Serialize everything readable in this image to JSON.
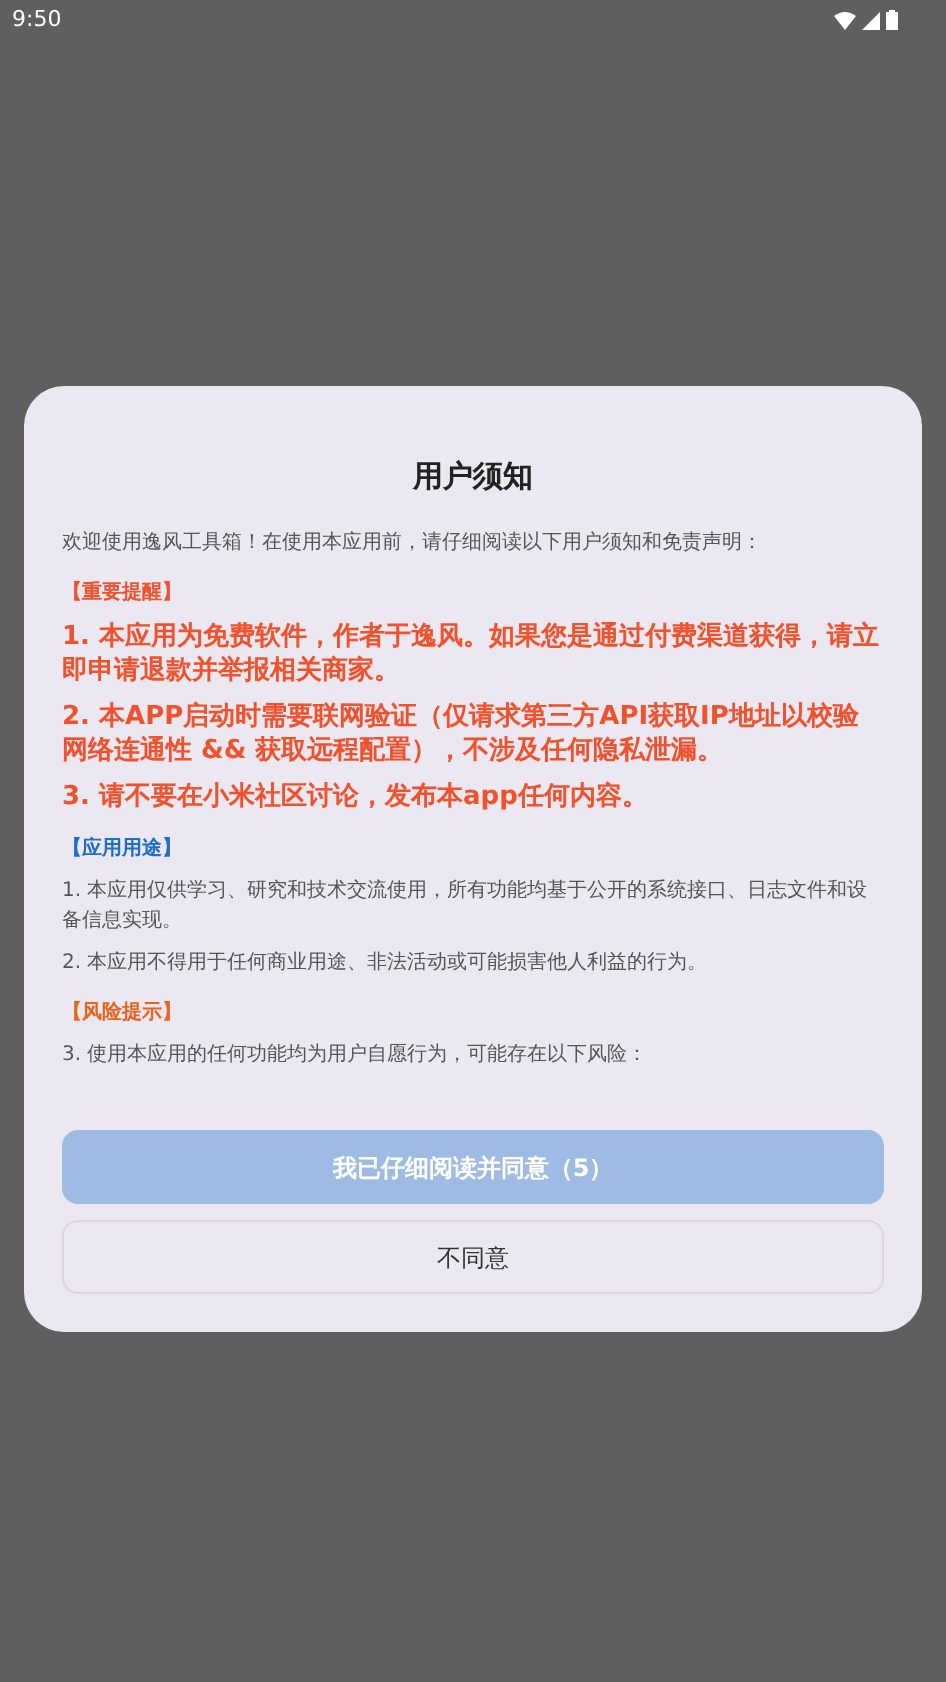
{
  "status_bar": {
    "time": "9:50"
  },
  "dialog": {
    "title": "用户须知",
    "blocks": [
      {
        "kind": "body",
        "text": "欢迎使用逸风工具箱！在使用本应用前，请仔细阅读以下用户须知和免责声明："
      },
      {
        "kind": "heading",
        "text": "【重要提醒】",
        "color": "#f0522e"
      },
      {
        "kind": "warning",
        "text": "1. 本应用为免费软件，作者于逸风。如果您是通过付费渠道获得，请立即申请退款并举报相关商家。"
      },
      {
        "kind": "warning",
        "text": "2. 本APP启动时需要联网验证（仅请求第三方API获取IP地址以校验网络连通性 && 获取远程配置），不涉及任何隐私泄漏。"
      },
      {
        "kind": "warning",
        "text": "3. 请不要在小米社区讨论，发布本app任何内容。"
      },
      {
        "kind": "heading",
        "text": "【应用用途】",
        "color": "#1e6fc7"
      },
      {
        "kind": "body",
        "text": "1. 本应用仅供学习、研究和技术交流使用，所有功能均基于公开的系统接口、日志文件和设备信息实现。"
      },
      {
        "kind": "body",
        "text": "2. 本应用不得用于任何商业用途、非法活动或可能损害他人利益的行为。"
      },
      {
        "kind": "heading",
        "text": "【风险提示】",
        "color": "#e8641e"
      },
      {
        "kind": "body",
        "text": "3. 使用本应用的任何功能均为用户自愿行为，可能存在以下风险："
      }
    ],
    "agree_button": {
      "label": "我已仔细阅读并同意（5）",
      "disabled": true
    },
    "decline_button": {
      "label": "不同意"
    }
  }
}
